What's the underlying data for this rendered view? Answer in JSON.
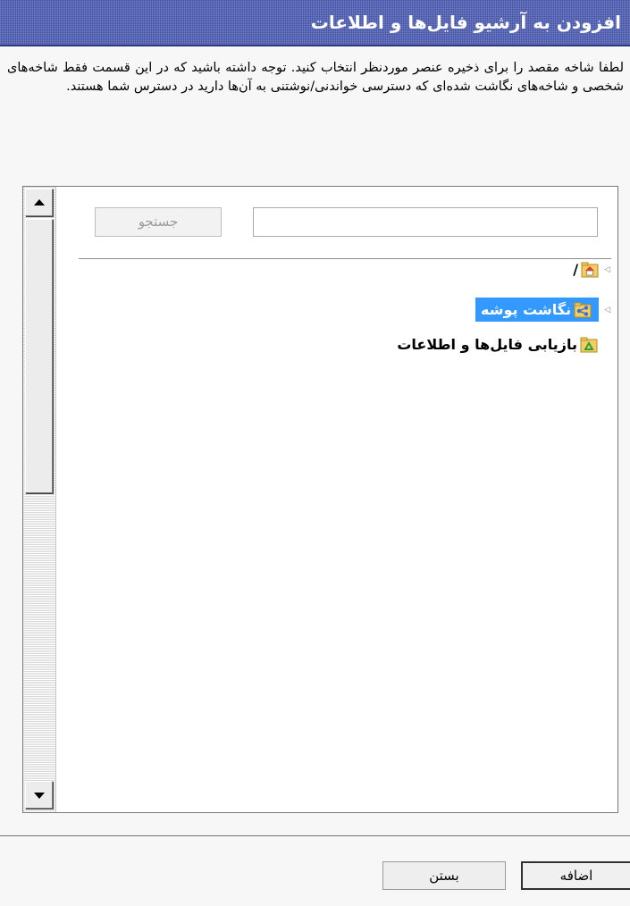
{
  "dialog": {
    "title": "افزودن به آرشیو فایل‌ها و اطلاعات",
    "instructions": "لطفا شاخه مقصد را برای ذخیره عنصر موردنظر انتخاب کنید. توجه داشته باشید که در این قسمت فقط شاخه‌های شخصی و شاخه‌های نگاشت شده‌ای که دسترسی خواندنی/نوشتنی به آن‌ها دارید در دسترس شما هستند."
  },
  "search": {
    "button_label": "جستجو",
    "value": ""
  },
  "tree": {
    "items": [
      {
        "label": "/",
        "icon": "home-folder-icon",
        "selected": false,
        "expandable": true
      },
      {
        "label": "نگاشت پوشه",
        "icon": "share-folder-icon",
        "selected": true,
        "expandable": true
      },
      {
        "label": "بازیابی فایل‌ها و اطلاعات",
        "icon": "recycle-folder-icon",
        "selected": false,
        "expandable": false
      }
    ]
  },
  "buttons": {
    "add_label": "اضافه",
    "close_label": "بستن"
  },
  "colors": {
    "titlebar": "#4252a8",
    "selection": "#3399ff"
  }
}
